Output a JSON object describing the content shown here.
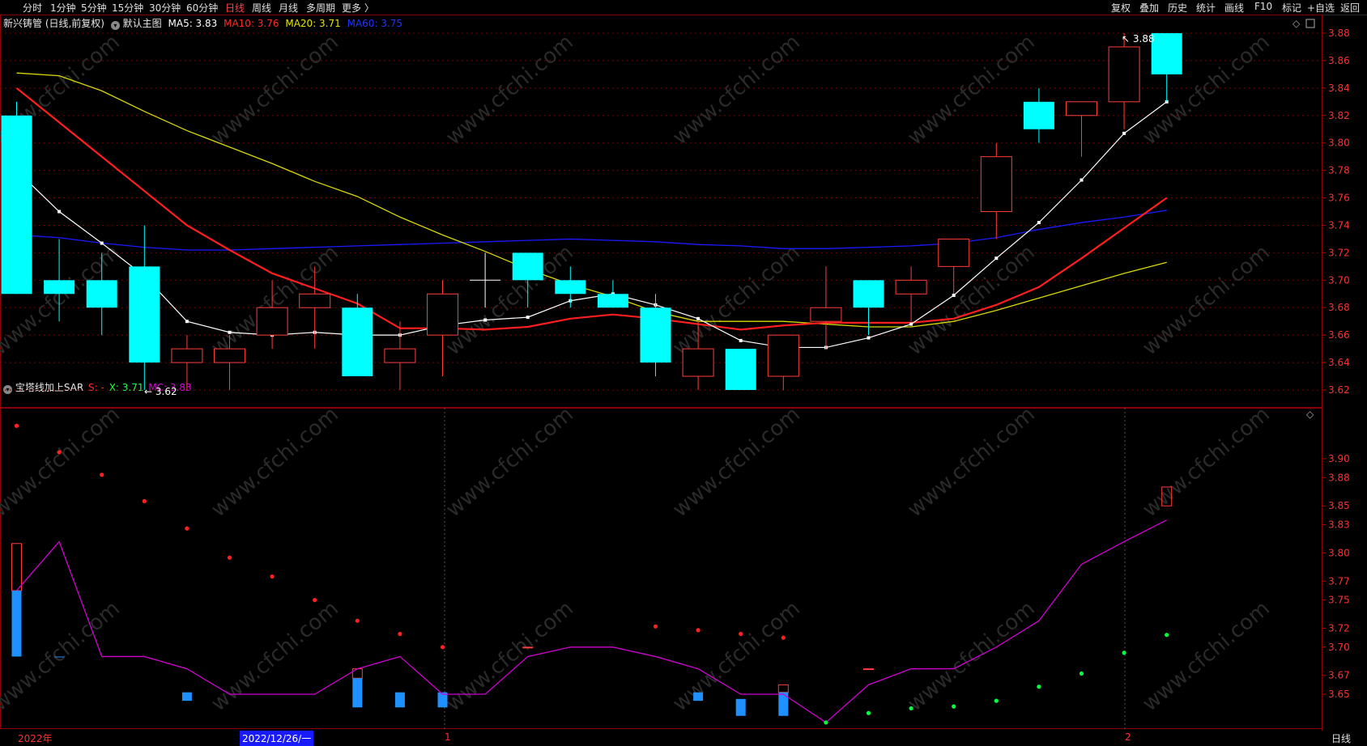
{
  "toolbar": {
    "left": [
      "分时",
      "1分钟",
      "5分钟",
      "15分钟",
      "30分钟",
      "60分钟",
      "日线",
      "周线",
      "月线",
      "多周期",
      "更多 〉"
    ],
    "active_index": 6,
    "right": [
      "复权",
      "叠加",
      "历史",
      "统计",
      "画线",
      "F10",
      "标记",
      "+自选",
      "返回"
    ]
  },
  "main_header": {
    "stock": "新兴铸管 (日线,前复权)",
    "template": "默认主图",
    "ma5": "MA5: 3.83",
    "ma10": "MA10: 3.76",
    "ma20": "MA20: 3.71",
    "ma60": "MA60: 3.75"
  },
  "sub_header": {
    "name": "宝塔线加上SAR",
    "s": "S: -",
    "x": "X: 3.71",
    "mc": "MC: 3.83"
  },
  "annotations": {
    "high": "3.88",
    "low": "3.62"
  },
  "main_axis": [
    "3.88",
    "3.86",
    "3.84",
    "3.82",
    "3.80",
    "3.78",
    "3.76",
    "3.74",
    "3.72",
    "3.70",
    "3.68",
    "3.66",
    "3.64",
    "3.62"
  ],
  "sub_axis": [
    "3.90",
    "3.88",
    "3.85",
    "3.83",
    "3.80",
    "3.77",
    "3.75",
    "3.72",
    "3.70",
    "3.67",
    "3.65"
  ],
  "date_bar": {
    "year": "2022年",
    "cursor_date": "2022/12/26/一",
    "month1": "1",
    "month2": "2",
    "period": "日线"
  },
  "watermark": "www.cfchi.com",
  "colors": {
    "up": "#ff3c3c",
    "down": "#00ffff",
    "ma5": "#ffffff",
    "ma10": "#ff1e1e",
    "ma20": "#d8d800",
    "ma60": "#1a1aff",
    "mc": "#d000d0",
    "sar_up": "#ff2020",
    "sar_down": "#00ff40",
    "tower_down": "#1e90ff"
  },
  "chart_data": {
    "type": "candlestick",
    "ylim": [
      3.61,
      3.89
    ],
    "candles": [
      {
        "o": 3.82,
        "c": 3.69,
        "h": 3.83,
        "l": 3.69
      },
      {
        "o": 3.7,
        "c": 3.69,
        "h": 3.73,
        "l": 3.67
      },
      {
        "o": 3.7,
        "c": 3.68,
        "h": 3.72,
        "l": 3.66
      },
      {
        "o": 3.71,
        "c": 3.64,
        "h": 3.74,
        "l": 3.62
      },
      {
        "o": 3.64,
        "c": 3.65,
        "h": 3.66,
        "l": 3.62
      },
      {
        "o": 3.64,
        "c": 3.65,
        "h": 3.66,
        "l": 3.62
      },
      {
        "o": 3.66,
        "c": 3.68,
        "h": 3.7,
        "l": 3.65
      },
      {
        "o": 3.68,
        "c": 3.69,
        "h": 3.71,
        "l": 3.65
      },
      {
        "o": 3.68,
        "c": 3.63,
        "h": 3.69,
        "l": 3.63
      },
      {
        "o": 3.64,
        "c": 3.65,
        "h": 3.67,
        "l": 3.62
      },
      {
        "o": 3.66,
        "c": 3.69,
        "h": 3.7,
        "l": 3.63
      },
      {
        "o": 3.7,
        "c": 3.7,
        "h": 3.72,
        "l": 3.68
      },
      {
        "o": 3.72,
        "c": 3.7,
        "h": 3.72,
        "l": 3.68
      },
      {
        "o": 3.7,
        "c": 3.69,
        "h": 3.71,
        "l": 3.68
      },
      {
        "o": 3.69,
        "c": 3.68,
        "h": 3.7,
        "l": 3.68
      },
      {
        "o": 3.68,
        "c": 3.64,
        "h": 3.69,
        "l": 3.63
      },
      {
        "o": 3.63,
        "c": 3.65,
        "h": 3.67,
        "l": 3.62
      },
      {
        "o": 3.65,
        "c": 3.62,
        "h": 3.65,
        "l": 3.62
      },
      {
        "o": 3.63,
        "c": 3.66,
        "h": 3.66,
        "l": 3.62
      },
      {
        "o": 3.67,
        "c": 3.68,
        "h": 3.71,
        "l": 3.65
      },
      {
        "o": 3.7,
        "c": 3.68,
        "h": 3.7,
        "l": 3.66
      },
      {
        "o": 3.69,
        "c": 3.7,
        "h": 3.71,
        "l": 3.67
      },
      {
        "o": 3.71,
        "c": 3.73,
        "h": 3.73,
        "l": 3.69
      },
      {
        "o": 3.75,
        "c": 3.79,
        "h": 3.8,
        "l": 3.73
      },
      {
        "o": 3.83,
        "c": 3.81,
        "h": 3.84,
        "l": 3.8
      },
      {
        "o": 3.82,
        "c": 3.83,
        "h": 3.83,
        "l": 3.79
      },
      {
        "o": 3.83,
        "c": 3.87,
        "h": 3.88,
        "l": 3.81
      },
      {
        "o": 3.88,
        "c": 3.85,
        "h": 3.88,
        "l": 3.83
      }
    ],
    "ma5": [
      3.78,
      3.75,
      3.727,
      3.703,
      3.67,
      3.662,
      3.66,
      3.662,
      3.66,
      3.66,
      3.667,
      3.671,
      3.673,
      3.685,
      3.69,
      3.682,
      3.672,
      3.656,
      3.651,
      3.651,
      3.658,
      3.668,
      3.689,
      3.716,
      3.742,
      3.773,
      3.807,
      3.83
    ],
    "ma10": [
      3.84,
      3.815,
      3.79,
      3.765,
      3.74,
      3.722,
      3.705,
      3.694,
      3.683,
      3.665,
      3.665,
      3.664,
      3.666,
      3.672,
      3.675,
      3.672,
      3.668,
      3.664,
      3.667,
      3.669,
      3.669,
      3.669,
      3.672,
      3.682,
      3.695,
      3.716,
      3.738,
      3.76
    ],
    "ma20": [
      3.851,
      3.849,
      3.838,
      3.823,
      3.809,
      3.797,
      3.785,
      3.772,
      3.761,
      3.746,
      3.733,
      3.721,
      3.708,
      3.697,
      3.688,
      3.677,
      3.67,
      3.67,
      3.67,
      3.668,
      3.666,
      3.666,
      3.67,
      3.678,
      3.687,
      3.696,
      3.705,
      3.713
    ],
    "ma60": [
      3.733,
      3.731,
      3.727,
      3.724,
      3.722,
      3.722,
      3.723,
      3.724,
      3.725,
      3.726,
      3.727,
      3.728,
      3.729,
      3.73,
      3.729,
      3.728,
      3.726,
      3.725,
      3.723,
      3.723,
      3.724,
      3.725,
      3.727,
      3.731,
      3.737,
      3.742,
      3.746,
      3.751
    ],
    "sub_ylim": [
      3.625,
      3.935
    ],
    "mc": [
      3.76,
      3.812,
      3.69,
      3.69,
      3.677,
      3.65,
      3.65,
      3.65,
      3.677,
      3.69,
      3.65,
      3.65,
      3.69,
      3.7,
      3.7,
      3.69,
      3.677,
      3.65,
      3.65,
      3.62,
      3.66,
      3.677,
      3.677,
      3.7,
      3.728,
      3.788,
      3.812,
      3.835
    ],
    "sar": [
      3.935,
      3.907,
      3.883,
      3.855,
      3.826,
      3.795,
      3.775,
      3.75,
      3.728,
      3.714,
      3.7,
      null,
      null,
      null,
      null,
      3.722,
      3.718,
      3.714,
      3.71,
      3.62,
      3.63,
      3.635,
      3.637,
      3.643,
      3.658,
      3.672,
      3.694,
      3.713
    ],
    "sar_up": [
      true,
      true,
      true,
      true,
      true,
      true,
      true,
      true,
      true,
      true,
      true,
      true,
      true,
      true,
      true,
      true,
      true,
      true,
      true,
      false,
      false,
      false,
      false,
      false,
      false,
      false,
      false,
      false
    ],
    "tower": [
      {
        "i": 0,
        "top": 3.81,
        "bot": 3.69,
        "mid": 3.76,
        "kind": "mix"
      },
      {
        "i": 1,
        "top": 3.69,
        "bot": 3.69,
        "mid": 3.69,
        "kind": "down"
      },
      {
        "i": 4,
        "top": 3.652,
        "bot": 3.643,
        "kind": "down"
      },
      {
        "i": 8,
        "top": 3.677,
        "bot": 3.636,
        "mid": 3.667,
        "kind": "mix"
      },
      {
        "i": 9,
        "top": 3.652,
        "bot": 3.636,
        "kind": "down"
      },
      {
        "i": 10,
        "top": 3.652,
        "bot": 3.636,
        "kind": "down"
      },
      {
        "i": 12,
        "top": 3.7,
        "bot": 3.7,
        "kind": "up"
      },
      {
        "i": 16,
        "top": 3.652,
        "bot": 3.643,
        "kind": "down"
      },
      {
        "i": 17,
        "top": 3.645,
        "bot": 3.627,
        "kind": "down"
      },
      {
        "i": 18,
        "top": 3.66,
        "bot": 3.627,
        "mid": 3.652,
        "kind": "mix"
      },
      {
        "i": 20,
        "top": 3.677,
        "bot": 3.677,
        "kind": "up"
      },
      {
        "i": 27,
        "top": 3.87,
        "bot": 3.85,
        "kind": "up"
      }
    ]
  }
}
